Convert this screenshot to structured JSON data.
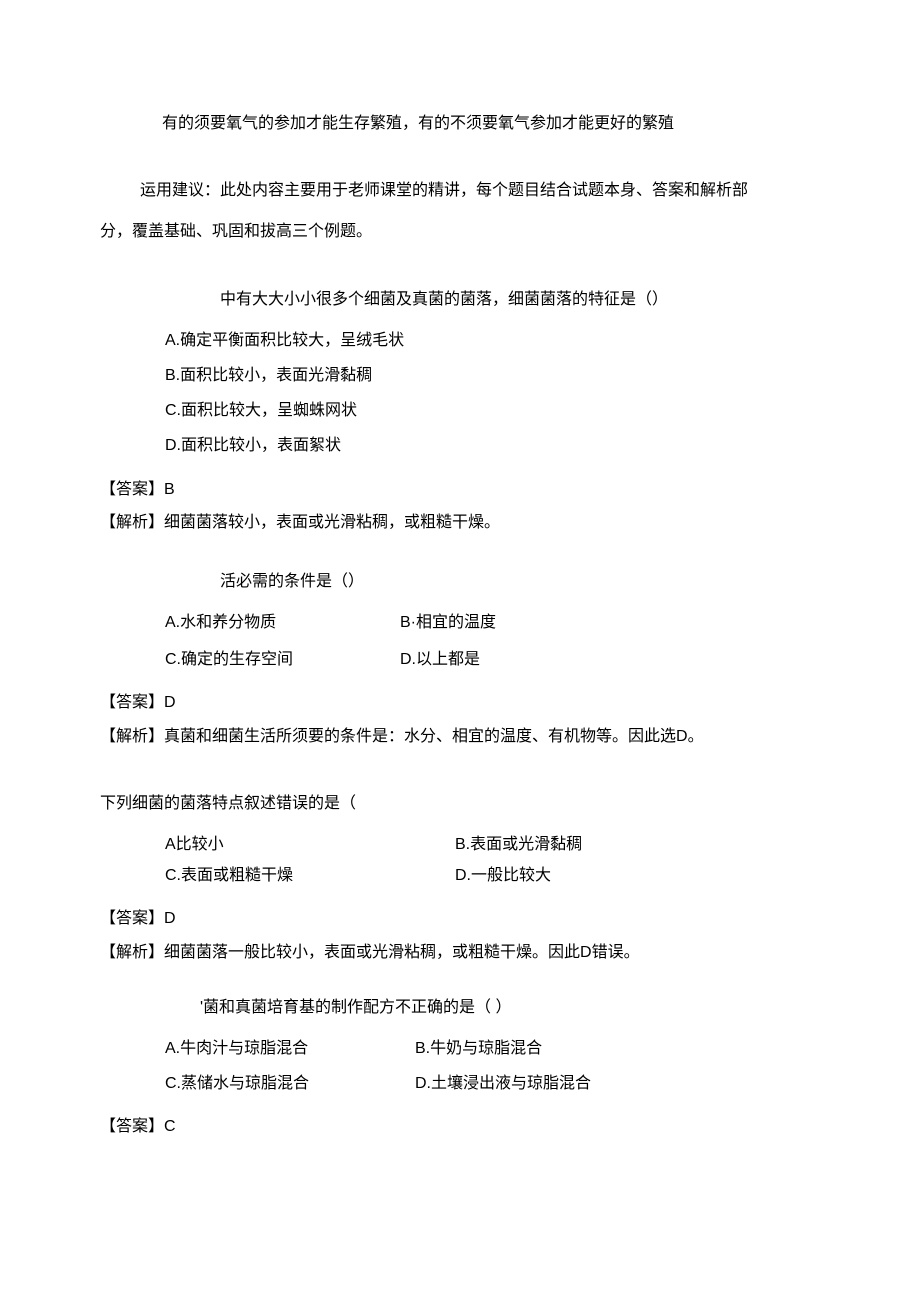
{
  "intro": "有的须要氧气的参加才能生存繁殖，有的不须要氧气参加才能更好的繁殖",
  "advice": "运用建议：此处内容主要用于老师课堂的精讲，每个题目结合试题本身、答案和解析部",
  "advice_cont": "分，覆盖基础、巩固和拔高三个例题。",
  "q1": {
    "stem": "中有大大小小很多个细菌及真菌的菌落，细菌菌落的特征是（）",
    "opts": {
      "a": "A.确定平衡面积比较大，呈绒毛状",
      "b": "B.面积比较小，表面光滑黏稠",
      "c": "C.面积比较大，呈蜘蛛网状",
      "d": "D.面积比较小，表面絮状"
    },
    "ans_label": "【答案】",
    "ans": "B",
    "exp_label": "【解析】",
    "exp": "细菌菌落较小，表面或光滑粘稠，或粗糙干燥。"
  },
  "q2": {
    "stem": "活必需的条件是（）",
    "opts": {
      "a": "A.水和养分物质",
      "b": "B·相宜的温度",
      "c": "C.确定的生存空间",
      "d": "D.以上都是"
    },
    "ans_label": "【答案】",
    "ans": "D",
    "exp_label": "【解析】",
    "exp": "真菌和细菌生活所须要的条件是：水分、相宜的温度、有机物等。因此选D。"
  },
  "q3": {
    "stem": "下列细菌的菌落特点叙述错误的是（",
    "opts": {
      "a": "A比较小",
      "b": "B.表面或光滑黏稠",
      "c": "C.表面或粗糙干燥",
      "d": "D.一般比较大"
    },
    "ans_label": "【答案】",
    "ans": "D",
    "exp_label": "【解析】",
    "exp": "细菌菌落一般比较小，表面或光滑粘稠，或粗糙干燥。因此D错误。"
  },
  "q4": {
    "stem": "'菌和真菌培育基的制作配方不正确的是（           ）",
    "opts": {
      "a": "A.牛肉汁与琼脂混合",
      "b": "B.牛奶与琼脂混合",
      "c": "C.蒸储水与琼脂混合",
      "d": "D.土壤浸出液与琼脂混合"
    },
    "ans_label": "【答案】",
    "ans": "C"
  }
}
